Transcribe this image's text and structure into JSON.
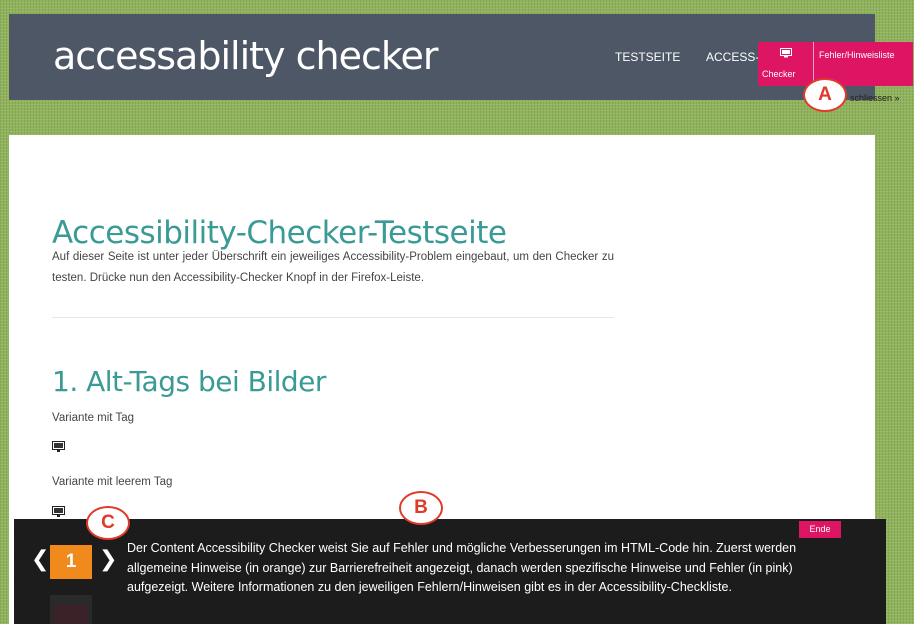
{
  "header": {
    "title": "accessability checker",
    "nav": [
      "TESTSEITE",
      "ACCESS-F"
    ]
  },
  "toolbar": {
    "checker_label": "Checker",
    "fehler_label": "Fehler/Hinweisliste",
    "schliessen": "schliessen »"
  },
  "callouts": {
    "a": "A",
    "b": "B",
    "c": "C"
  },
  "main": {
    "page_title": "Accessibility-Checker-Testseite",
    "intro": "Auf dieser Seite ist unter jeder Überschrift ein jeweiliges Accessibility-Problem eingebaut, um den Checker zu testen. Drücke nun den Accessibility-Checker Knopf in der Firefox-Leiste.",
    "section_title": "1. Alt-Tags bei Bilder",
    "variants": [
      "Variante mit Tag",
      "Variante mit leerem Tag"
    ]
  },
  "panel": {
    "end_label": "Ende",
    "step_number": "1",
    "prev": "❮",
    "next": "❯",
    "text": "Der Content Accessibility Checker weist Sie auf Fehler und mögliche Verbesserungen im HTML-Code hin. Zuerst werden allgemeine Hinweise (in orange) zur Barrierefreiheit angezeigt, danach werden spezifische Hinweise und Fehler (in pink) aufgezeigt. Weitere Informationen zu den jeweiligen Fehlern/Hinweisen gibt es in der Accessibility-Checkliste."
  },
  "icons": {
    "toolbar": "monitor-icon",
    "images": "image-placeholder-icon"
  },
  "colors": {
    "background": "#8fb25a",
    "header": "#4e5766",
    "accent_pink": "#dd1563",
    "heading_teal": "#3a9a95",
    "step_orange": "#f08a1d",
    "callout_red": "#e03a2a",
    "panel": "#1c1c1c"
  }
}
